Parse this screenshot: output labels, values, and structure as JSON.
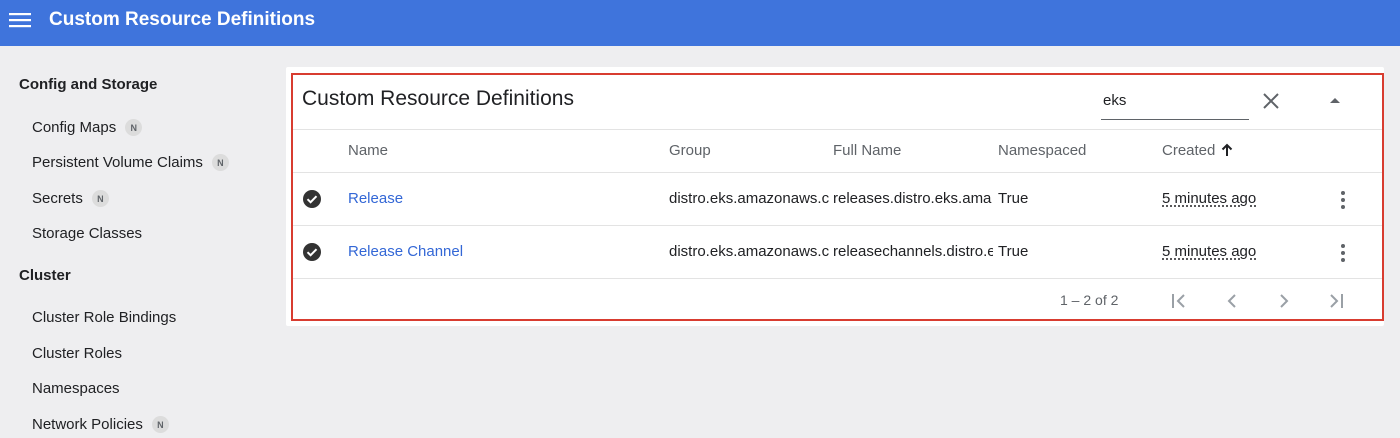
{
  "header": {
    "title": "Custom Resource Definitions",
    "bar_color": "#3f74dc"
  },
  "sidebar": {
    "sections": [
      {
        "title": "Config and Storage",
        "items": [
          {
            "label": "Config Maps",
            "badge": "N"
          },
          {
            "label": "Persistent Volume Claims",
            "badge": "N"
          },
          {
            "label": "Secrets",
            "badge": "N"
          },
          {
            "label": "Storage Classes",
            "badge": ""
          }
        ]
      },
      {
        "title": "Cluster",
        "items": [
          {
            "label": "Cluster Role Bindings",
            "badge": ""
          },
          {
            "label": "Cluster Roles",
            "badge": ""
          },
          {
            "label": "Namespaces",
            "badge": ""
          },
          {
            "label": "Network Policies",
            "badge": "N"
          }
        ]
      }
    ]
  },
  "card": {
    "title": "Custom Resource Definitions",
    "filter_value": "eks",
    "highlight_color": "#d83c30"
  },
  "table": {
    "columns": [
      "Name",
      "Group",
      "Full Name",
      "Namespaced",
      "Created"
    ],
    "sorted_column": "Created",
    "sort_direction": "ascending",
    "rows": [
      {
        "name": "Release",
        "group": "distro.eks.amazonaws.c",
        "full_name": "releases.distro.eks.ama",
        "namespaced": "True",
        "created": "5 minutes ago",
        "status": "check-circle-icon"
      },
      {
        "name": "Release Channel",
        "group": "distro.eks.amazonaws.c",
        "full_name": "releasechannels.distro.e",
        "namespaced": "True",
        "created": "5 minutes ago",
        "status": "check-circle-icon"
      }
    ]
  },
  "pagination": {
    "range_text": "1 – 2 of 2"
  }
}
